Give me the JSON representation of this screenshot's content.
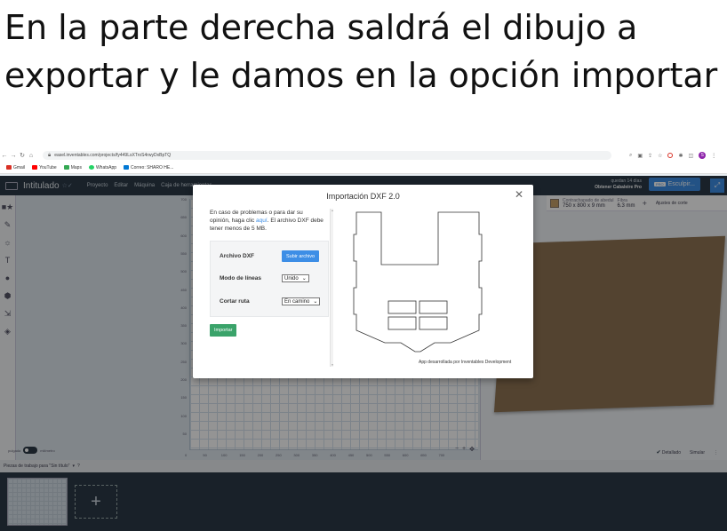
{
  "caption": "En la parte derecha saldrá el dibujo a exportar y le damos en la opción importar",
  "browser": {
    "url": "easel.inventables.com/projects/fy449LsXTroS4rwyDxBpTQ",
    "bookmarks": [
      "Gmail",
      "YouTube",
      "Maps",
      "WhatsApp",
      "Correo: SHARO HE..."
    ]
  },
  "app": {
    "title": "Intitulado",
    "menu": [
      "Proyecto",
      "Editar",
      "Máquina",
      "Caja de herramientas"
    ],
    "trial_line1": "quedan 14 días",
    "trial_line2": "Obtener Cabaleire Pro",
    "pro_tag": "PRO",
    "carve_label": "Esculpir..."
  },
  "canvas": {
    "y_ticks": [
      "700",
      "650",
      "600",
      "550",
      "500",
      "450",
      "400",
      "350",
      "300",
      "250",
      "200",
      "150",
      "100",
      "50"
    ],
    "x_ticks": [
      "0",
      "50",
      "100",
      "150",
      "200",
      "250",
      "300",
      "350",
      "400",
      "450",
      "500",
      "550",
      "600",
      "650",
      "700"
    ],
    "units_left": "pulgada",
    "units_right": "milímetro"
  },
  "material": {
    "name_label": "Contrachapado de abedul",
    "size_value": "750 x 800 x 9 mm",
    "grosor_label": "Fibra",
    "grosor_value": "6.3 mm",
    "cut_settings": "Ajustes de corte"
  },
  "preview_footer": {
    "detail": "Detallado",
    "simulate": "Simular"
  },
  "workpieces": {
    "label": "Piezas de trabajo para \"Sin título\""
  },
  "modal": {
    "title": "Importación DXF 2.0",
    "help_before": "En caso de problemas o para dar su opinión, haga clic",
    "help_link": "aquí",
    "help_after": ". El archivo DXF debe tener menos de 5 MB.",
    "file_label": "Archivo DXF",
    "upload_button": "Subir archivo",
    "line_mode_label": "Modo de líneas",
    "line_mode_value": "Unido",
    "cut_path_label": "Cortar ruta",
    "cut_path_value": "En camino",
    "import_button": "Importar",
    "credit": "App desarrollada por Inventables Development"
  },
  "colors": {
    "app_bar": "#2b3947",
    "accent_blue": "#3d8ee6",
    "import_green": "#3aa36a",
    "material": "#8f7453"
  }
}
